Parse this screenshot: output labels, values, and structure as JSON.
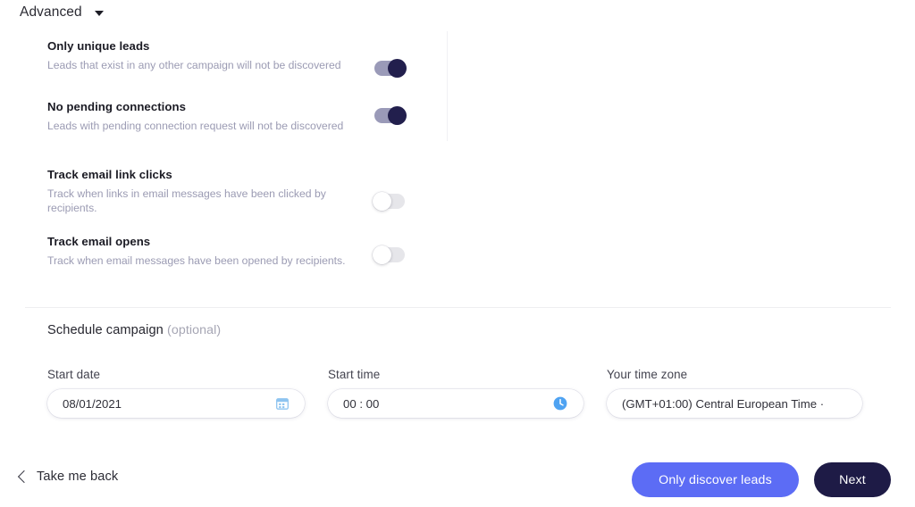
{
  "header": {
    "title": "Advanced",
    "caret_icon": "chevron-down-icon"
  },
  "toggle_groups": [
    {
      "id": "lead-filters",
      "rows": [
        {
          "title": "Only unique leads",
          "description": "Leads that exist in any other campaign will not be discovered",
          "toggle_state": "on"
        },
        {
          "title": "No pending connections",
          "description": "Leads with pending connection request will not be discovered",
          "toggle_state": "on"
        }
      ]
    },
    {
      "id": "email-tracking",
      "rows": [
        {
          "title": "Track email link clicks",
          "description": "Track when links in email messages have been clicked by recipients.",
          "toggle_state": "off"
        },
        {
          "title": "Track email opens",
          "description": "Track when email messages have been opened by recipients.",
          "toggle_state": "off"
        }
      ]
    }
  ],
  "schedule": {
    "title": "Schedule campaign",
    "optional_suffix": "(optional)",
    "fields": {
      "start_date": {
        "label": "Start date",
        "value": "08/01/2021",
        "icon": "calendar-icon"
      },
      "start_time": {
        "label": "Start time",
        "value": "00 : 00",
        "icon": "clock-icon"
      },
      "time_zone": {
        "label": "Your time zone",
        "value": "(GMT+01:00) Central European Time ·",
        "icon": "none"
      }
    }
  },
  "footer": {
    "back_label": "Take me back",
    "back_icon": "chevron-left-icon",
    "discover_label": "Only discover leads",
    "next_label": "Next"
  },
  "colors": {
    "toggle_on_track": "#9a9ab8",
    "toggle_on_knob": "#221f4d",
    "toggle_off_track": "#e6e6ea",
    "primary_button": "#5c6cf5",
    "dark_button": "#1e1b46",
    "accent_icon": "#5aa9f0",
    "description_text": "#9b9bb3"
  }
}
